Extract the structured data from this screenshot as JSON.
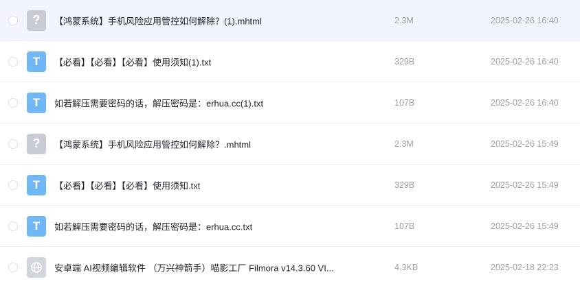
{
  "files": [
    {
      "name": "【鸿蒙系统】手机风险应用管控如何解除？(1).mhtml",
      "size": "2.3M",
      "date": "2025-02-26 16:40",
      "icon": "unknown-file-icon",
      "icon_glyph": "?",
      "selected": true
    },
    {
      "name": "【必看】【必看】【必看】使用须知(1).txt",
      "size": "329B",
      "date": "2025-02-26 16:40",
      "icon": "txt-file-icon",
      "icon_glyph": "T",
      "selected": false
    },
    {
      "name": "如若解压需要密码的话，解压密码是：erhua.cc(1).txt",
      "size": "107B",
      "date": "2025-02-26 16:40",
      "icon": "txt-file-icon",
      "icon_glyph": "T",
      "selected": false
    },
    {
      "name": "【鸿蒙系统】手机风险应用管控如何解除？.mhtml",
      "size": "2.3M",
      "date": "2025-02-26 15:49",
      "icon": "unknown-file-icon",
      "icon_glyph": "?",
      "selected": false
    },
    {
      "name": "【必看】【必看】【必看】使用须知.txt",
      "size": "329B",
      "date": "2025-02-26 15:49",
      "icon": "txt-file-icon",
      "icon_glyph": "T",
      "selected": false
    },
    {
      "name": "如若解压需要密码的话，解压密码是：erhua.cc.txt",
      "size": "107B",
      "date": "2025-02-26 15:49",
      "icon": "txt-file-icon",
      "icon_glyph": "T",
      "selected": false
    },
    {
      "name": "安卓端 AI视频编辑软件 （万兴神箭手）喵影工厂 Filmora v14.3.60 VI...",
      "size": "4.3KB",
      "date": "2025-02-18 22:23",
      "icon": "web-link-icon",
      "icon_glyph": "",
      "selected": false
    }
  ],
  "colors": {
    "selected_row": "#f2f5fe",
    "txt_icon": "#6fb8f5",
    "unknown_icon": "#c9ccd4",
    "muted_text": "#9aa0aa"
  }
}
